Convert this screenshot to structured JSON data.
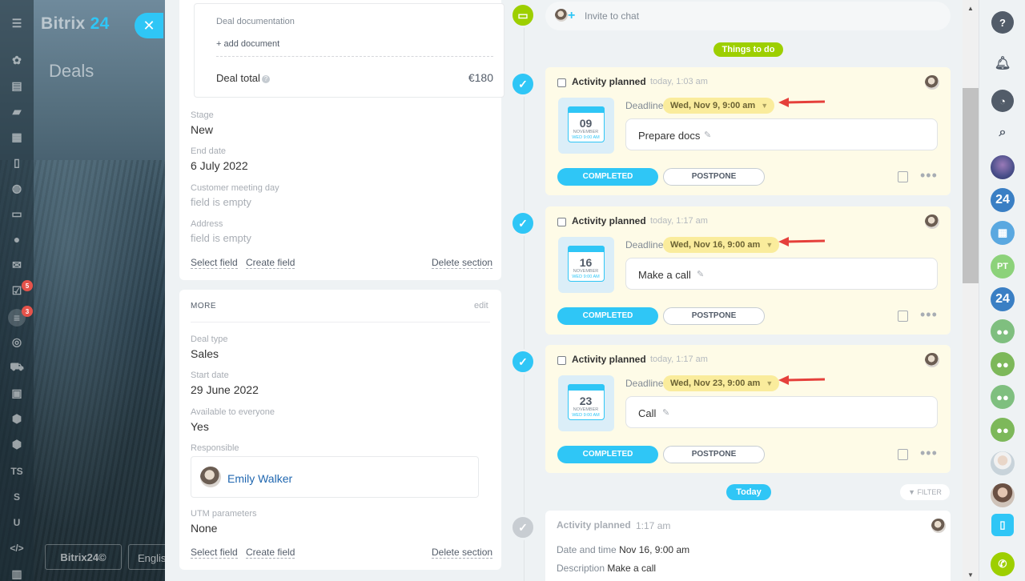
{
  "app": {
    "brand_name": "Bitrix",
    "brand_suffix": "24",
    "page_title": "Deals",
    "close_icon": "✕",
    "footer_brand": "Bitrix24©",
    "footer_lang": "English"
  },
  "left_nav": {
    "badges": [
      "5",
      "3"
    ],
    "text_items": [
      "TS",
      "S",
      "U"
    ]
  },
  "details": {
    "doc_title": "Deal documentation",
    "add_document": "+ add document",
    "deal_total_label": "Deal total",
    "deal_total_value": "€180",
    "fields": [
      {
        "label": "Stage",
        "value": "New"
      },
      {
        "label": "End date",
        "value": "6 July 2022"
      },
      {
        "label": "Customer meeting day",
        "value": "field is empty"
      },
      {
        "label": "Address",
        "value": "field is empty"
      }
    ],
    "select_field": "Select field",
    "create_field": "Create field",
    "delete_section": "Delete section"
  },
  "more": {
    "header": "MORE",
    "edit": "edit",
    "fields": [
      {
        "label": "Deal type",
        "value": "Sales"
      },
      {
        "label": "Start date",
        "value": "29 June 2022"
      },
      {
        "label": "Available to everyone",
        "value": "Yes"
      }
    ],
    "responsible_label": "Responsible",
    "responsible_name": "Emily Walker",
    "utm_label": "UTM parameters",
    "utm_value": "None",
    "select_field": "Select field",
    "create_field": "Create field",
    "delete_section": "Delete section"
  },
  "timeline": {
    "invite": "Invite to chat",
    "things_to_do": "Things to do",
    "today": "Today",
    "filter": "FILTER",
    "deadline_label": "Deadline",
    "completed": "COMPLETED",
    "postpone": "POSTPONE",
    "activities": [
      {
        "title": "Activity planned",
        "time": "today, 1:03 am",
        "day": "09",
        "month": "NOVEMBER",
        "weekday": "WED 9:00 AM",
        "deadline": "Wed, Nov 9, 9:00 am",
        "description": "Prepare docs"
      },
      {
        "title": "Activity planned",
        "time": "today, 1:17 am",
        "day": "16",
        "month": "NOVEMBER",
        "weekday": "WED 9:00 AM",
        "deadline": "Wed, Nov 16, 9:00 am",
        "description": "Make a call"
      },
      {
        "title": "Activity planned",
        "time": "today, 1:17 am",
        "day": "23",
        "month": "NOVEMBER",
        "weekday": "WED 9:00 AM",
        "deadline": "Wed, Nov 23, 9:00 am",
        "description": "Call"
      }
    ],
    "history": {
      "title": "Activity planned",
      "time": "1:17 am",
      "date_label": "Date and time",
      "date_value": "Nov 16, 9:00 am",
      "desc_label": "Description",
      "desc_value": "Make a call"
    }
  },
  "right_bar": {
    "items": [
      "help-icon",
      "bell-icon",
      "chat-icon",
      "search-icon",
      "avatar",
      "24",
      "calendar-icon",
      "PT",
      "24",
      "group-icon",
      "group-icon",
      "group-icon",
      "group-icon",
      "avatar",
      "avatar",
      "phone-transfer-icon",
      "call-icon"
    ],
    "pt": "PT",
    "b24": "24"
  },
  "colors": {
    "accent": "#2fc6f6",
    "green": "#9dcf00",
    "yellow_card": "#fefbe7",
    "deadline_pill": "#faec9c",
    "arrow": "#e5403b"
  }
}
